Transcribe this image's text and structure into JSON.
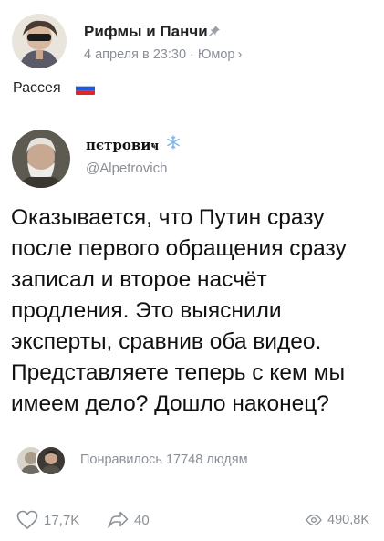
{
  "post": {
    "group_name": "Рифмы и Панчи",
    "date": "4 апреля в 23:30",
    "category": "Юмор",
    "category_chevron": "›",
    "separator": "·",
    "text": "Рассея",
    "pin_icon": "pin-icon",
    "flag_icon": "russia-flag-icon"
  },
  "tweet": {
    "author_name": "пєтровиҹ",
    "handle": "@Alpetrovich",
    "text": "Оказывается, что Путин сразу после первого обращения сразу записал и второе насчёт продления. Это выяснили эксперты, сравнив оба видео. Представляете теперь с кем мы имеем дело? Дошло наконец?",
    "badge_icon": "snowflake-icon"
  },
  "likes": {
    "text": "Понравилось 17748 людям"
  },
  "actions": {
    "like_count": "17,7K",
    "share_count": "40",
    "views_count": "490,8K"
  },
  "colors": {
    "text": "#222222",
    "secondary": "#8a8f96",
    "flag_white": "#ffffff",
    "flag_blue": "#1f5bd8",
    "flag_red": "#e0262b",
    "snowflake": "#7fb6e8"
  }
}
